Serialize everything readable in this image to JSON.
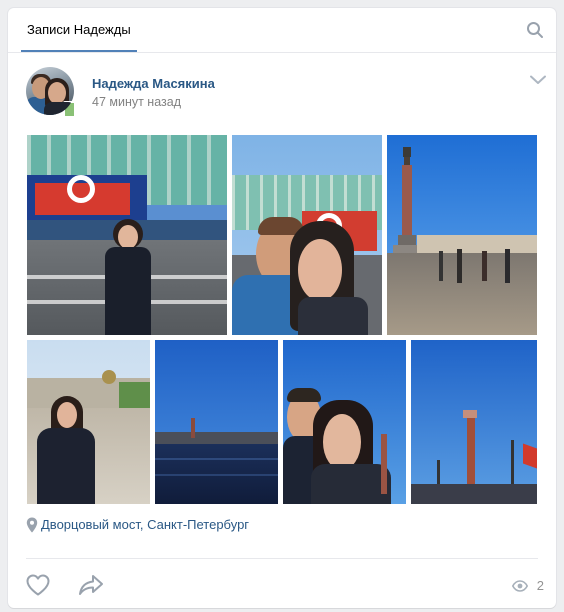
{
  "header": {
    "tab_label": "Записи Надежды",
    "search_icon": "search-icon"
  },
  "post": {
    "author": {
      "name": "Надежда Масякина",
      "time": "47 минут назад",
      "online": "mobile",
      "menu_icon": "chevron-down-icon"
    },
    "photos": [
      "winter-palace-victory-day-woman",
      "couple-selfie-winter-palace",
      "alexander-column-palace-square",
      "woman-on-street",
      "neva-river-view",
      "couple-selfie-rostral-column",
      "rostral-column-street"
    ],
    "location": {
      "icon": "location-pin-icon",
      "text": "Дворцовый мост, Санкт-Петербург"
    },
    "actions": {
      "like_icon": "heart-icon",
      "share_icon": "share-arrow-icon",
      "views_icon": "eye-icon",
      "views_count": "2"
    }
  },
  "colors": {
    "link": "#2a5885",
    "accent": "#5181b8",
    "meta": "#828282",
    "icon": "#99a2ad",
    "online": "#8ac176"
  }
}
